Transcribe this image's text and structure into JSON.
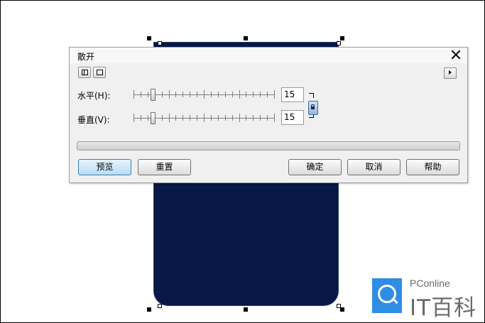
{
  "dialog": {
    "title": "散开",
    "horizontal": {
      "label": "水平(H):",
      "value": "15",
      "slider_fraction": 0.15
    },
    "vertical": {
      "label": "垂直(V):",
      "value": "15",
      "slider_fraction": 0.15
    },
    "buttons": {
      "preview": "预览",
      "reset": "重置",
      "ok": "确定",
      "cancel": "取消",
      "help": "帮助"
    }
  },
  "watermark": {
    "brand_latin": "PConline",
    "brand_cn": "IT百科"
  },
  "colors": {
    "shape_fill": "#071847",
    "accent": "#3c7fb1",
    "logo": "#2f8de4"
  }
}
